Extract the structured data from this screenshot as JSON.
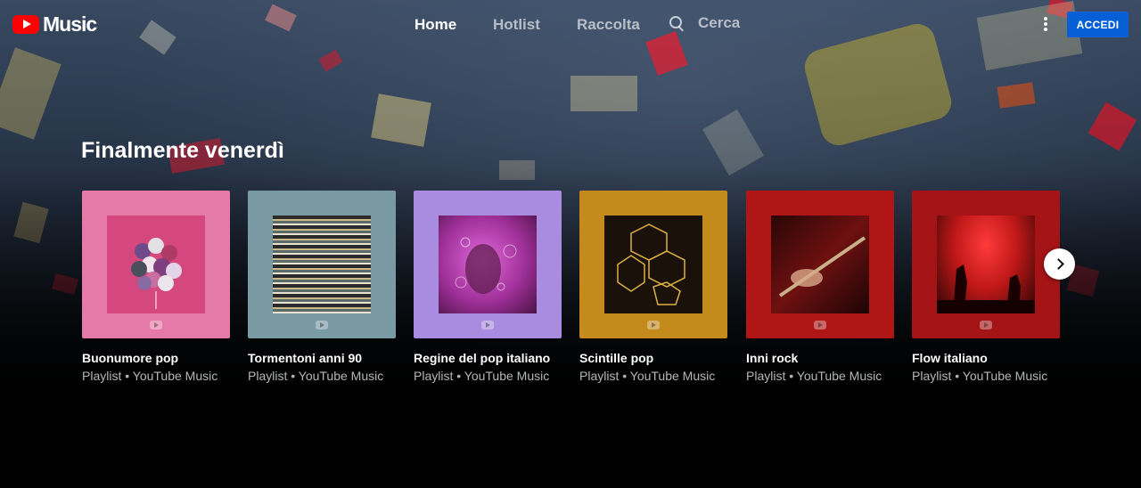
{
  "header": {
    "logo_text": "Music",
    "nav": {
      "home": "Home",
      "hotlist": "Hotlist",
      "library": "Raccolta",
      "search": "Cerca"
    },
    "signin_label": "ACCEDI"
  },
  "shelf": {
    "title": "Finalmente venerdì",
    "items": [
      {
        "title": "Buonumore pop",
        "subtitle": "Playlist • YouTube Music",
        "color": "#e57aa8"
      },
      {
        "title": "Tormentoni anni 90",
        "subtitle": "Playlist • YouTube Music",
        "color": "#7a9aa3"
      },
      {
        "title": "Regine del pop italiano",
        "subtitle": "Playlist • YouTube Music",
        "color": "#a98ce0"
      },
      {
        "title": "Scintille pop",
        "subtitle": "Playlist • YouTube Music",
        "color": "#c48b1c"
      },
      {
        "title": "Inni rock",
        "subtitle": "Playlist • YouTube Music",
        "color": "#b01616"
      },
      {
        "title": "Flow italiano",
        "subtitle": "Playlist • YouTube Music",
        "color": "#a41416"
      }
    ]
  },
  "colors": {
    "accent": "#065fd4",
    "brand": "#ff0000"
  }
}
